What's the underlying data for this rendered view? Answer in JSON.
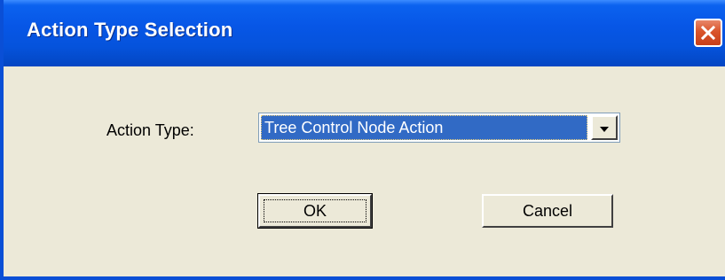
{
  "window": {
    "title": "Action Type Selection",
    "close_icon": "close-icon"
  },
  "form": {
    "action_type_label": "Action Type:",
    "action_type_value": "Tree Control Node Action",
    "dropdown_icon": "chevron-down-icon"
  },
  "buttons": {
    "ok_label": "OK",
    "cancel_label": "Cancel"
  },
  "colors": {
    "titlebar": "#0756e6",
    "close_button": "#d9542a",
    "dialog_background": "#ece9d8",
    "selection_highlight": "#316ac5"
  }
}
